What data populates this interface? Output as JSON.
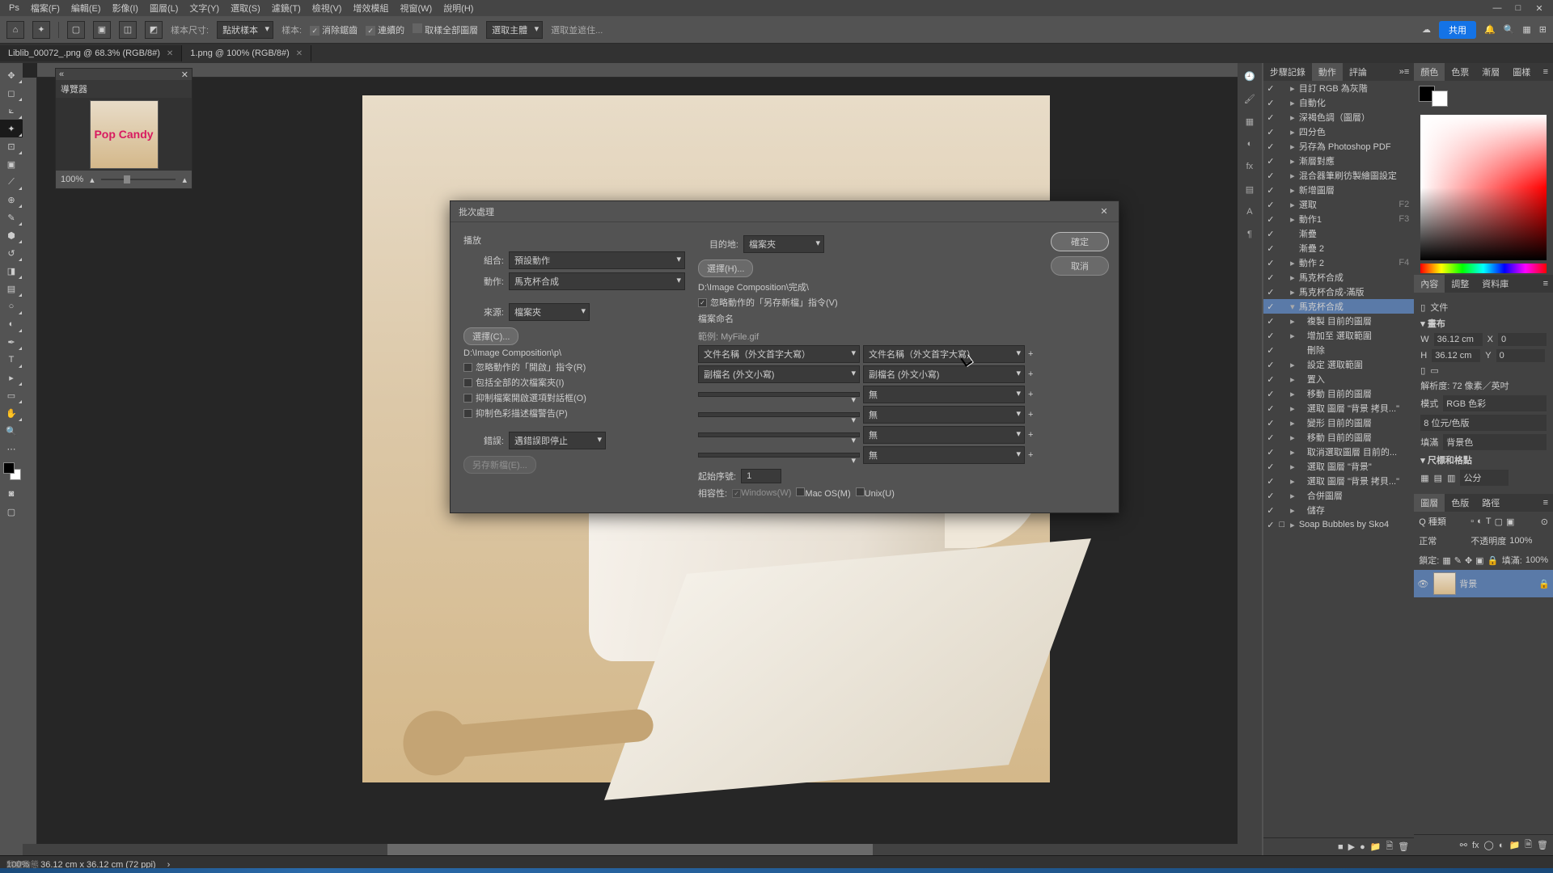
{
  "menu": [
    "檔案(F)",
    "編輯(E)",
    "影像(I)",
    "圖層(L)",
    "文字(Y)",
    "選取(S)",
    "濾鏡(T)",
    "檢視(V)",
    "增效模組",
    "視窗(W)",
    "說明(H)"
  ],
  "win": [
    "—",
    "□",
    "✕"
  ],
  "optbar": {
    "scale_label": "樣本尺寸:",
    "scale_value": "點狀樣本",
    "sample_label": "樣本:",
    "anti": "消除鋸齒",
    "contig": "連續的",
    "allLayers": "取樣全部圖層",
    "sel_subject": "選取主體",
    "sel_edge": "選取並遮住..."
  },
  "rightIcons": {
    "share": "共用"
  },
  "tabs": [
    {
      "name": "Liblib_00072_.png @ 68.3% (RGB/8#)"
    },
    {
      "name": "1.png @ 100% (RGB/8#)"
    }
  ],
  "nav": {
    "title": "導覽器",
    "zoom": "100%",
    "thumb": "Pop Candy"
  },
  "status": {
    "zoom": "100%",
    "dims": "36.12 cm x 36.12 cm (72 ppi)",
    "hint": "動畫動態"
  },
  "panelTabs": {
    "actions": [
      "步驟記錄",
      "動作",
      "評論"
    ],
    "color": [
      "顏色",
      "色票",
      "漸層",
      "圖樣"
    ],
    "props": [
      "內容",
      "調整",
      "資料庫"
    ],
    "layers": [
      "圖層",
      "色版",
      "路徑"
    ]
  },
  "actions": [
    {
      "l": 0,
      "chk": "✓",
      "exp": "▸",
      "nm": "目訂 RGB 為灰階"
    },
    {
      "l": 0,
      "chk": "✓",
      "exp": "▸",
      "nm": "自動化"
    },
    {
      "l": 0,
      "chk": "✓",
      "exp": "▸",
      "nm": "深褐色調（圖層）"
    },
    {
      "l": 0,
      "chk": "✓",
      "exp": "▸",
      "nm": "四分色"
    },
    {
      "l": 0,
      "chk": "✓",
      "exp": "▸",
      "nm": "另存為 Photoshop PDF"
    },
    {
      "l": 0,
      "chk": "✓",
      "exp": "▸",
      "nm": "漸層對應"
    },
    {
      "l": 0,
      "chk": "✓",
      "exp": "▸",
      "nm": "混合器筆刷彷製繪圖設定"
    },
    {
      "l": 0,
      "chk": "✓",
      "exp": "▸",
      "nm": "新增圖層"
    },
    {
      "l": 0,
      "chk": "✓",
      "exp": "▸",
      "nm": "選取",
      "key": "F2"
    },
    {
      "l": 0,
      "chk": "✓",
      "exp": "▸",
      "nm": "動作1",
      "key": "F3"
    },
    {
      "l": 0,
      "chk": "✓",
      "exp": "",
      "nm": "漸疊"
    },
    {
      "l": 0,
      "chk": "✓",
      "exp": "",
      "nm": "漸疊 2"
    },
    {
      "l": 0,
      "chk": "✓",
      "exp": "▸",
      "nm": "動作 2",
      "key": "F4"
    },
    {
      "l": 0,
      "chk": "✓",
      "exp": "▸",
      "nm": "馬克杯合成"
    },
    {
      "l": 0,
      "chk": "✓",
      "exp": "▸",
      "nm": "馬克杯合成-滿版"
    },
    {
      "l": 0,
      "chk": "✓",
      "exp": "▾",
      "nm": "馬克杯合成",
      "sel": true
    },
    {
      "l": 1,
      "chk": "✓",
      "exp": "▸",
      "nm": "複製 目前的圖層"
    },
    {
      "l": 1,
      "chk": "✓",
      "exp": "▸",
      "nm": "增加至 選取範圍"
    },
    {
      "l": 1,
      "chk": "✓",
      "exp": "",
      "nm": "刪除"
    },
    {
      "l": 1,
      "chk": "✓",
      "exp": "▸",
      "nm": "設定 選取範圍"
    },
    {
      "l": 1,
      "chk": "✓",
      "exp": "▸",
      "nm": "置入"
    },
    {
      "l": 1,
      "chk": "✓",
      "exp": "▸",
      "nm": "移動 目前的圖層"
    },
    {
      "l": 1,
      "chk": "✓",
      "exp": "▸",
      "nm": "選取 圖層 \"背景 拷貝...\""
    },
    {
      "l": 1,
      "chk": "✓",
      "exp": "▸",
      "nm": "變形 目前的圖層"
    },
    {
      "l": 1,
      "chk": "✓",
      "exp": "▸",
      "nm": "移動 目前的圖層"
    },
    {
      "l": 1,
      "chk": "✓",
      "exp": "▸",
      "nm": "取消選取圖層 目前的..."
    },
    {
      "l": 1,
      "chk": "✓",
      "exp": "▸",
      "nm": "選取 圖層 \"背景\""
    },
    {
      "l": 1,
      "chk": "✓",
      "exp": "▸",
      "nm": "選取 圖層 \"背景 拷貝...\""
    },
    {
      "l": 1,
      "chk": "✓",
      "exp": "▸",
      "nm": "合併圖層"
    },
    {
      "l": 1,
      "chk": "✓",
      "exp": "▸",
      "nm": "儲存"
    },
    {
      "l": 0,
      "chk": "✓",
      "exp": "▸",
      "typ": "□",
      "nm": "Soap Bubbles by Sko4"
    }
  ],
  "actbtns": [
    "■",
    "▶",
    "●",
    "📁",
    "🗎",
    "🗑"
  ],
  "props": {
    "head": "文件",
    "canvas": "畫布",
    "w": "36.12 cm",
    "h": "36.12 cm",
    "x": "0",
    "y": "0",
    "res": "解析度: 72 像素／英吋",
    "mode_l": "模式",
    "mode_v": "RGB 色彩",
    "depth": "8 位元/色版",
    "fill_l": "填滿",
    "fill_v": "背景色"
  },
  "rulers": {
    "title": "尺標和格點",
    "unit": "公分"
  },
  "layers": {
    "kind": "Q 種類",
    "blend": "正常",
    "opacity": "不透明度",
    "opv": "100%",
    "lock": "鎖定:",
    "fill": "填滿:",
    "fillv": "100%",
    "layer": "背景",
    "lockicon": "🔒"
  },
  "dialog": {
    "title": "批次處理",
    "play": "播放",
    "set_l": "組合:",
    "set_v": "預設動作",
    "action_l": "動作:",
    "action_v": "馬克杯合成",
    "source_l": "來源:",
    "source_v": "檔案夾",
    "choose_src": "選擇(C)...",
    "src_path": "D:\\Image Composition\\p\\",
    "ov_open": "忽略動作的「開啟」指令(R)",
    "inc_sub": "包括全部的次檔案夾(I)",
    "sup_fileopen": "抑制檔案開啟選項對話框(O)",
    "sup_color": "抑制色彩描述檔警告(P)",
    "errors_l": "錯誤:",
    "errors_v": "遇錯誤即停止",
    "save_err": "另存新檔(E)...",
    "dest_l": "目的地:",
    "dest_v": "檔案夾",
    "choose_dst": "選擇(H)...",
    "dst_path": "D:\\Image Composition\\完成\\",
    "ov_save": "忽略動作的「另存新檔」指令(V)",
    "filenaming": "檔案命名",
    "example": "範例: MyFile.gif",
    "fn": [
      [
        "文件名稱（外文首字大寫）",
        "文件名稱（外文首字大寫）"
      ],
      [
        "副檔名 (外文小寫)",
        "副檔名 (外文小寫)"
      ],
      [
        "",
        "無"
      ],
      [
        "",
        "無"
      ],
      [
        "",
        "無"
      ],
      [
        "",
        "無"
      ]
    ],
    "start_l": "起始序號:",
    "start_v": "1",
    "compat_l": "相容性:",
    "win": "Windows(W)",
    "mac": "Mac OS(M)",
    "unix": "Unix(U)",
    "ok": "確定",
    "cancel": "取消"
  }
}
